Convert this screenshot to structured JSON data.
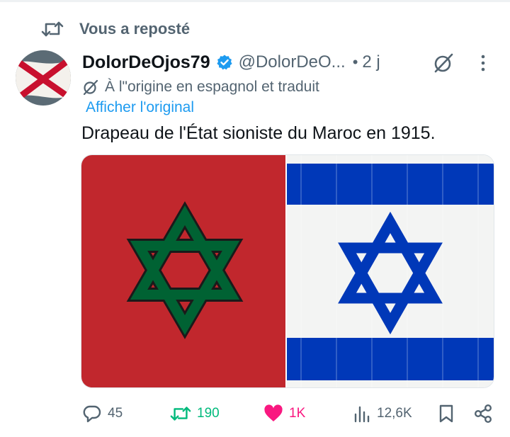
{
  "repost_header": {
    "label": "Vous a reposté"
  },
  "author": {
    "display_name": "DolorDeOjos79",
    "handle": "@DolorDeO...",
    "separator": "•",
    "time": "2 j"
  },
  "translation": {
    "note": "À l\"origine en espagnol et traduit",
    "show_original": "Afficher l'original"
  },
  "tweet": {
    "text": "Drapeau de l'État sioniste du Maroc en 1915."
  },
  "stats": {
    "replies": "45",
    "reposts": "190",
    "likes": "1K",
    "views": "12,6K"
  },
  "colors": {
    "accent": "#1d9bf0",
    "repost_active": "#00ba7c",
    "like_active": "#f91880",
    "muted": "#536471",
    "morocco_red": "#c1272d",
    "morocco_green": "#006233",
    "israel_blue": "#0038b8"
  },
  "icons": {
    "repost_header": "repost-icon",
    "verified": "verified-badge-icon",
    "grok": "grok-icon",
    "more": "more-vertical-icon",
    "translate": "translate-icon",
    "reply": "reply-icon",
    "repost": "repost-icon",
    "like": "heart-filled-icon",
    "views": "views-icon",
    "bookmark": "bookmark-icon",
    "share": "share-icon"
  }
}
